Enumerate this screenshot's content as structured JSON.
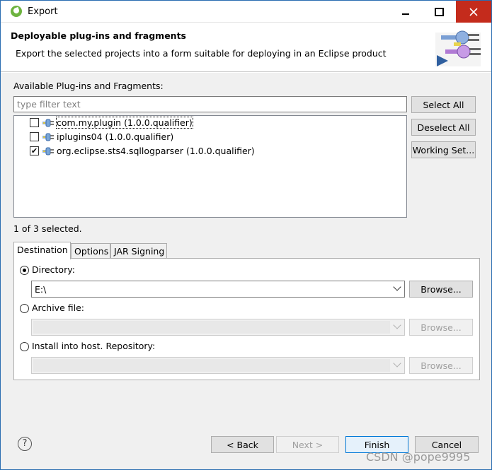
{
  "window": {
    "title": "Export"
  },
  "banner": {
    "title": "Deployable plug-ins and fragments",
    "description": "Export the selected projects into a form suitable for deploying in an Eclipse product"
  },
  "plugins": {
    "label": "Available Plug-ins and Fragments:",
    "filter_placeholder": "type filter text",
    "items": [
      {
        "label": "com.my.plugin (1.0.0.qualifier)",
        "checked": false
      },
      {
        "label": "iplugins04 (1.0.0.qualifier)",
        "checked": false
      },
      {
        "label": "org.eclipse.sts4.sqllogparser (1.0.0.qualifier)",
        "checked": true
      }
    ],
    "selection_status": "1 of 3 selected.",
    "buttons": {
      "select_all": "Select All",
      "deselect_all": "Deselect All",
      "working_set": "Working Set..."
    }
  },
  "tabs": [
    {
      "label": "Destination",
      "active": true
    },
    {
      "label": "Options",
      "active": false
    },
    {
      "label": "JAR Signing",
      "active": false
    }
  ],
  "destination": {
    "directory_label": "Directory:",
    "directory_value": "E:\\",
    "archive_label": "Archive file:",
    "install_label": "Install into host. Repository:",
    "browse_label": "Browse...",
    "selected": "directory"
  },
  "footer": {
    "back": "< Back",
    "next": "Next >",
    "finish": "Finish",
    "cancel": "Cancel",
    "watermark": "CSDN @pope9995"
  },
  "colors": {
    "accent": "#0078d7",
    "close_button": "#c42b1c",
    "spring_green": "#6db33f"
  }
}
